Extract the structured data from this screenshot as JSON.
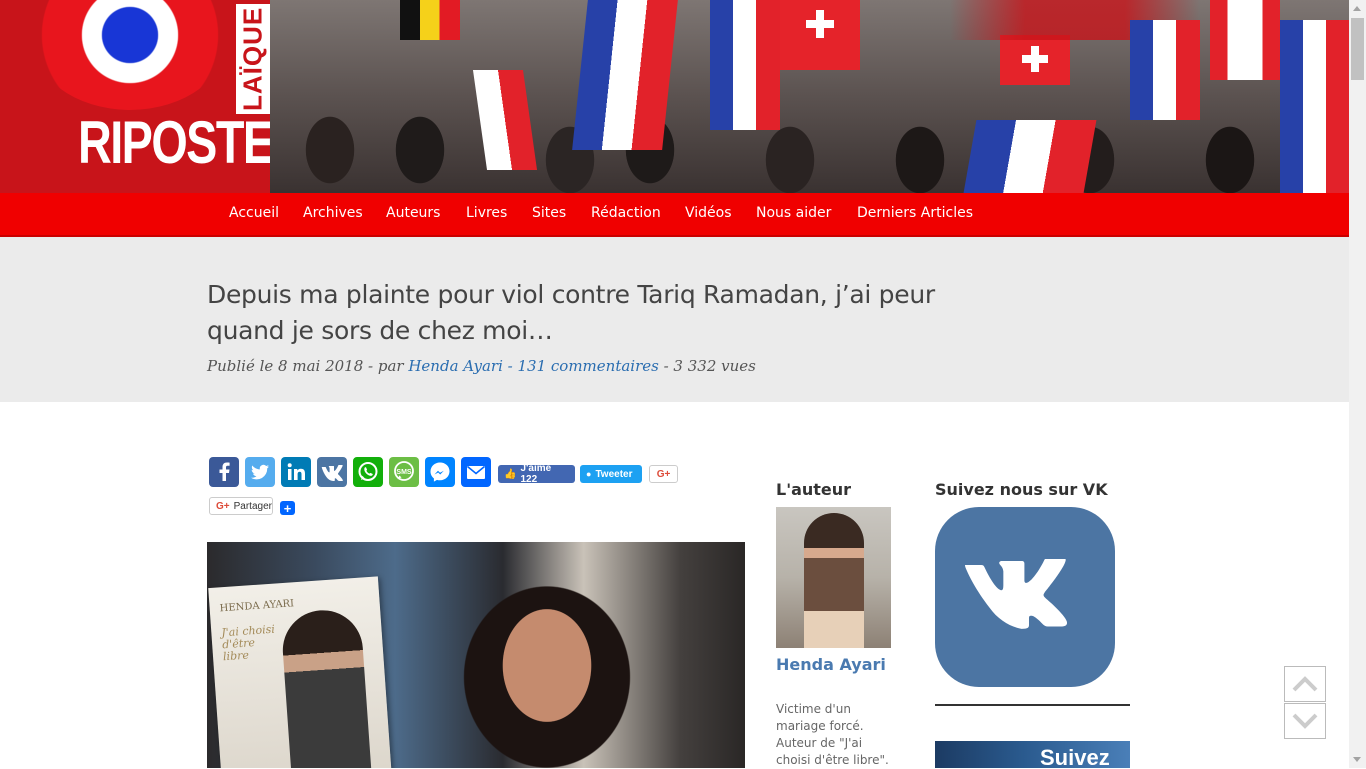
{
  "site": {
    "logo_main": "RIPOSTE",
    "logo_side": "LAÏQUE"
  },
  "nav": {
    "items": [
      {
        "label": "Accueil"
      },
      {
        "label": "Archives"
      },
      {
        "label": "Auteurs"
      },
      {
        "label": "Livres"
      },
      {
        "label": "Sites"
      },
      {
        "label": "Rédaction"
      },
      {
        "label": "Vidéos"
      },
      {
        "label": "Nous aider"
      },
      {
        "label": "Derniers Articles"
      }
    ]
  },
  "article": {
    "title": "Depuis ma plainte pour viol contre Tariq Ramadan, j’ai peur quand je sors de chez moi…",
    "meta_prefix": "Publié le 8 mai 2018 - par ",
    "meta_author": "Henda Ayari",
    "meta_sep": " - ",
    "meta_comments": "131 commentaires",
    "meta_views": " - 3 332 vues",
    "image_book_author": "HENDA AYARI",
    "image_book_title": "J'ai choisi d'être libre"
  },
  "share": {
    "icons": [
      "facebook-icon",
      "twitter-icon",
      "linkedin-icon",
      "vk-icon",
      "whatsapp-icon",
      "sms-icon",
      "messenger-icon",
      "email-icon"
    ],
    "fb_like_label": "J'aime 122",
    "tweet_label": "Tweeter",
    "gplus_label": "G+",
    "gplus_share_label": "Partager",
    "add_label": "+"
  },
  "sidebar": {
    "author_heading": "L'auteur",
    "author_name": "Henda Ayari",
    "author_bio": "Victime d'un mariage forcé. Auteur de \"J'ai choisi d'être libre\".",
    "vk_heading": "Suivez nous sur VK",
    "vk_banner_text": "Suivez"
  },
  "colors": {
    "nav_bg": "#f00000",
    "title_band": "#ebebeb",
    "link": "#2a6db0",
    "vk_blue": "#4c75a3"
  }
}
